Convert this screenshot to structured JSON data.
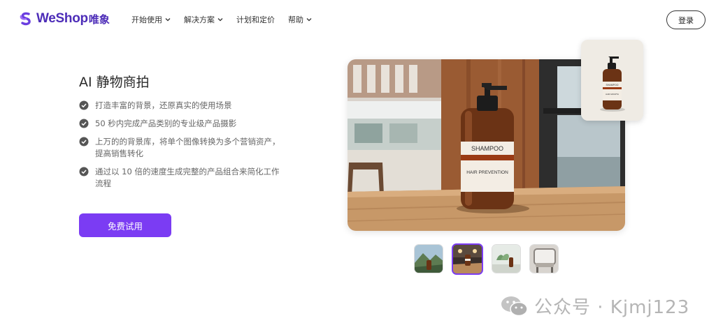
{
  "nav": {
    "logo_text": "WeShop",
    "logo_cn": "唯象",
    "items": [
      {
        "label": "开始使用",
        "has_dropdown": true
      },
      {
        "label": "解决方案",
        "has_dropdown": true
      },
      {
        "label": "计划和定价",
        "has_dropdown": false
      },
      {
        "label": "帮助",
        "has_dropdown": true
      }
    ],
    "login_label": "登录"
  },
  "main": {
    "title": "AI 静物商拍",
    "features": [
      "打造丰富的背景，还原真实的使用场景",
      "50 秒内完成产品类别的专业级产品摄影",
      "上万的的背景库，将单个图像转换为多个营销资产，提高销售转化",
      "通过以 10 倍的速度生成完整的产品组合来简化工作流程"
    ],
    "cta_label": "免费试用"
  },
  "hero": {
    "label_top": "SHAMPOO",
    "label_mid": "HAIR PREVENTION",
    "small_label_top": "SHAMPOO",
    "small_label_mid": "HAIR GROWTH"
  },
  "thumbnails": {
    "items": [
      "mountain-scene",
      "bathroom-counter-scene",
      "plant-scene",
      "chair-scene"
    ],
    "active_index": 1
  },
  "watermark": {
    "text": "公众号 · Kjmj123"
  },
  "colors": {
    "brand": "#4d2db8",
    "accent": "#7b3cf3"
  }
}
